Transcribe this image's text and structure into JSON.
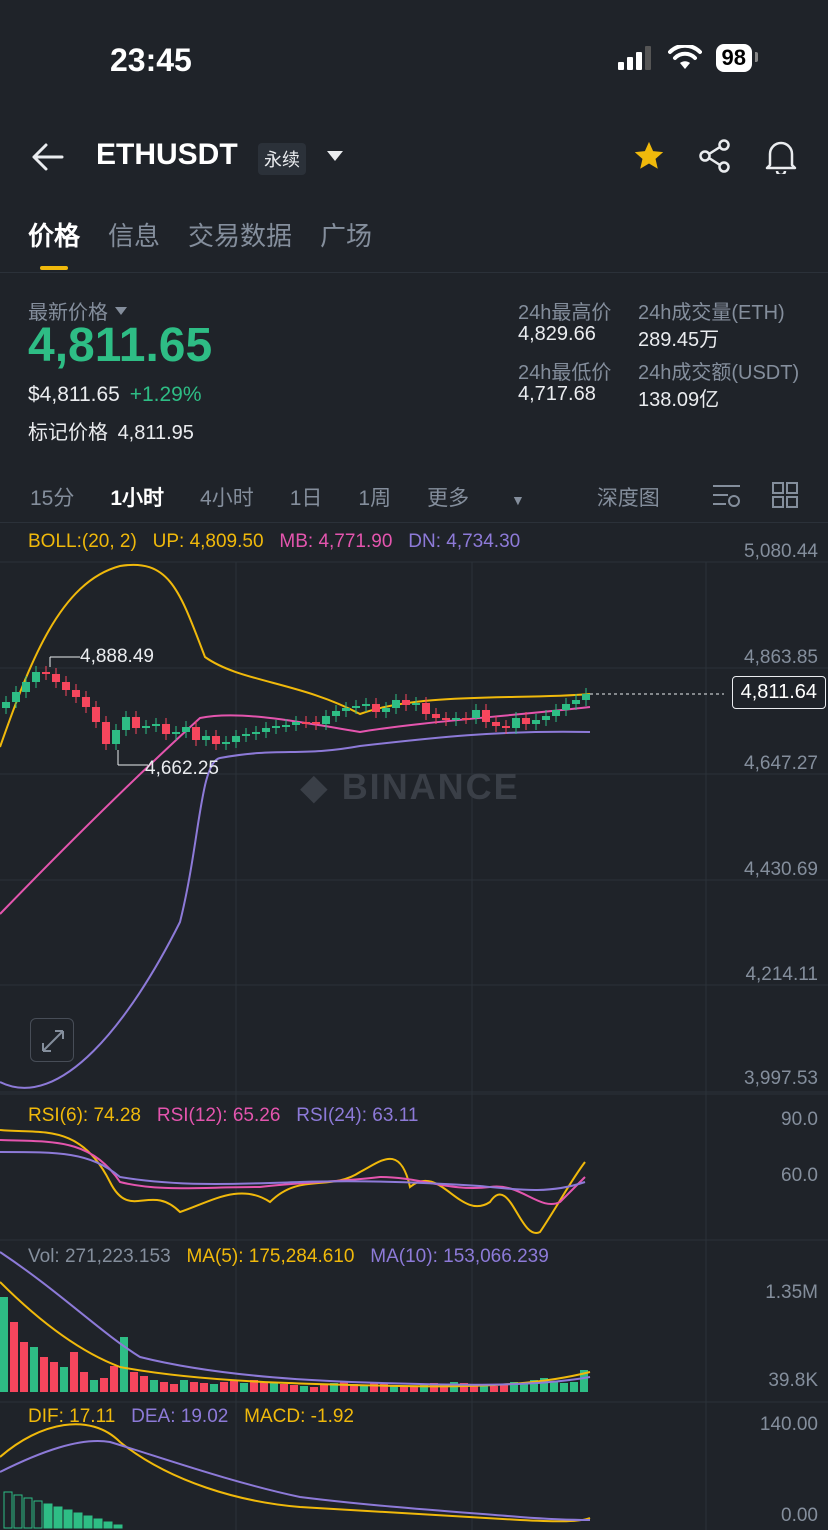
{
  "status": {
    "time": "23:45",
    "battery": "98"
  },
  "header": {
    "pair": "ETHUSDT",
    "badge": "永续"
  },
  "tabs": [
    "价格",
    "信息",
    "交易数据",
    "广场"
  ],
  "ticker": {
    "latest_label": "最新价格",
    "last_price": "4,811.65",
    "usd_price": "$4,811.65",
    "change": "+1.29%",
    "mark_label": "标记价格",
    "mark_price": "4,811.95",
    "high_label": "24h最高价",
    "high": "4,829.66",
    "low_label": "24h最低价",
    "low": "4,717.68",
    "vol_eth_label": "24h成交量(ETH)",
    "vol_eth": "289.45万",
    "vol_usdt_label": "24h成交额(USDT)",
    "vol_usdt": "138.09亿"
  },
  "intervals": [
    "15分",
    "1小时",
    "4小时",
    "1日",
    "1周",
    "更多",
    "深度图"
  ],
  "boll": {
    "label": "BOLL:(20, 2)",
    "up": "UP: 4,809.50",
    "mb": "MB: 4,771.90",
    "dn": "DN: 4,734.30"
  },
  "price_axis": [
    "5,080.44",
    "4,863.85",
    "4,647.27",
    "4,430.69",
    "4,214.11",
    "3,997.53"
  ],
  "chart_marks": {
    "high": "4,888.49",
    "low": "4,662.25",
    "current": "4,811.64"
  },
  "watermark": "BINANCE",
  "rsi": {
    "r6": "RSI(6): 74.28",
    "r12": "RSI(12): 65.26",
    "r24": "RSI(24): 63.11",
    "axis": [
      "90.0",
      "60.0"
    ]
  },
  "vol": {
    "vol": "Vol: 271,223.153",
    "ma5": "MA(5): 175,284.610",
    "ma10": "MA(10): 153,066.239",
    "axis": [
      "1.35M",
      "39.8K"
    ]
  },
  "macd": {
    "dif": "DIF: 17.11",
    "dea": "DEA: 19.02",
    "macd": "MACD: -1.92",
    "axis": [
      "140.00",
      "0.00"
    ]
  },
  "colors": {
    "up": "#2ebd85",
    "down": "#f6465d",
    "accent": "#f0b90b",
    "pink": "#e455ae",
    "purple": "#8d7ad8"
  }
}
